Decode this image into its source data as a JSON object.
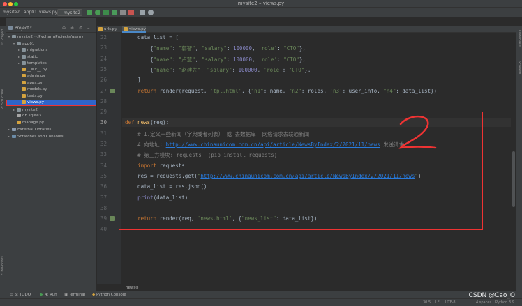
{
  "window": {
    "title": "mysite2 – views.py"
  },
  "toolbar": {
    "breadcrumbs": [
      "mysite2",
      "app01",
      "views.py"
    ],
    "run_config": "mysite2"
  },
  "left_stripe": {
    "tabs": [
      "1: Project",
      "2: Structure",
      "2: Favorites"
    ]
  },
  "right_stripe": {
    "tabs": [
      "Database",
      "SciView"
    ]
  },
  "project": {
    "title": "Project",
    "tree": [
      {
        "label": "mysite2  ~/PycharmProjects/gs/my",
        "indent": 0,
        "arrow": "▾",
        "icon": "folder"
      },
      {
        "label": "app01",
        "indent": 1,
        "arrow": "▾",
        "icon": "folder"
      },
      {
        "label": "migrations",
        "indent": 2,
        "arrow": "▸",
        "icon": "folder"
      },
      {
        "label": "static",
        "indent": 2,
        "arrow": "▸",
        "icon": "folder"
      },
      {
        "label": "templates",
        "indent": 2,
        "arrow": "▸",
        "icon": "folder"
      },
      {
        "label": "__init__.py",
        "indent": 2,
        "arrow": "",
        "icon": "py"
      },
      {
        "label": "admin.py",
        "indent": 2,
        "arrow": "",
        "icon": "py"
      },
      {
        "label": "apps.py",
        "indent": 2,
        "arrow": "",
        "icon": "py"
      },
      {
        "label": "models.py",
        "indent": 2,
        "arrow": "",
        "icon": "py"
      },
      {
        "label": "tests.py",
        "indent": 2,
        "arrow": "",
        "icon": "py"
      },
      {
        "label": "views.py",
        "indent": 2,
        "arrow": "",
        "icon": "py",
        "selected": true
      },
      {
        "label": "mysite2",
        "indent": 1,
        "arrow": "▸",
        "icon": "folder"
      },
      {
        "label": "db.sqlite3",
        "indent": 1,
        "arrow": "",
        "icon": "db"
      },
      {
        "label": "manage.py",
        "indent": 1,
        "arrow": "",
        "icon": "py"
      },
      {
        "label": "External Libraries",
        "indent": 0,
        "arrow": "▸",
        "icon": "lib"
      },
      {
        "label": "Scratches and Consoles",
        "indent": 0,
        "arrow": "▸",
        "icon": "scratch"
      }
    ]
  },
  "editor": {
    "tabs": [
      {
        "label": "urls.py",
        "active": false
      },
      {
        "label": "views.py",
        "active": true
      }
    ],
    "lines": [
      {
        "n": "22",
        "html": "    <span>data_list = [</span>"
      },
      {
        "n": "23",
        "html": "        {<span class='s'>\"name\"</span>: <span class='s'>\"郭智\"</span>, <span class='s'>\"salary\"</span>: <span class='b'>100000</span>, <span class='s'>'role'</span>: <span class='s'>\"CTO\"</span>},"
      },
      {
        "n": "24",
        "html": "        {<span class='s'>\"name\"</span>: <span class='s'>\"卢慧\"</span>, <span class='s'>\"salary\"</span>: <span class='b'>100000</span>, <span class='s'>'role'</span>: <span class='s'>\"CTO\"</span>},"
      },
      {
        "n": "25",
        "html": "        {<span class='s'>\"name\"</span>: <span class='s'>\"赵建先\"</span>, <span class='s'>\"salary\"</span>: <span class='b'>100000</span>, <span class='s'>'role'</span>: <span class='s'>\"CTO\"</span>},"
      },
      {
        "n": "26",
        "html": "    ]"
      },
      {
        "n": "27",
        "html": "    <span class='k'>return</span> render(request, <span class='s'>'tpl.html'</span>, {<span class='s'>\"n1\"</span>: name, <span class='s'>\"n2\"</span>: roles, <span class='s'>'n3'</span>: user_info, <span class='s'>\"n4\"</span>: data_list})"
      },
      {
        "n": "28",
        "html": ""
      },
      {
        "n": "29",
        "html": ""
      },
      {
        "n": "30",
        "html": "<span class='k'>def</span> <span class='f'>news</span>(req):",
        "current": true
      },
      {
        "n": "31",
        "html": "    <span class='c'># 1.定义一些新闻（字典或者列表） 或 去数据库  网络请求去联通新闻</span>"
      },
      {
        "n": "32",
        "html": "    <span class='c'># 向地址: </span><span class='u'>http://www.chinaunicom.com.cn/api/article/NewsByIndex/2/2021/11/news</span><span class='c'> 发送请求</span>"
      },
      {
        "n": "33",
        "html": "    <span class='c'># 第三方模块: requests  (pip install requests)</span>"
      },
      {
        "n": "34",
        "html": "    <span class='k'>import</span> requests"
      },
      {
        "n": "35",
        "html": "    res = requests.get(<span class='s'>\"</span><span class='u'>http://www.chinaunicom.com.cn/api/article/NewsByIndex/2/2021/11/news</span><span class='s'>\"</span>)"
      },
      {
        "n": "36",
        "html": "    data_list = res.json()"
      },
      {
        "n": "37",
        "html": "    <span class='b'>print</span>(data_list)"
      },
      {
        "n": "38",
        "html": ""
      },
      {
        "n": "39",
        "html": "    <span class='k'>return</span> render(req, <span class='s'>'news.html'</span>, {<span class='s'>\"news_list\"</span>: data_list})"
      },
      {
        "n": "40",
        "html": ""
      }
    ],
    "breadcrumb": "news()"
  },
  "bottom_tools": [
    "6: TODO",
    "4: Run",
    "Terminal",
    "Python Console"
  ],
  "status": {
    "position": "30:5",
    "line_sep": "LF",
    "encoding": "UTF-8",
    "indent": "4 spaces",
    "interpreter": "Python 3.9"
  },
  "watermark": "CSDN @Cao_O",
  "colors": {
    "selection": "#2f65ca",
    "highlight_box": "#e33333",
    "keyword": "#cc7832",
    "string": "#6a8759"
  }
}
